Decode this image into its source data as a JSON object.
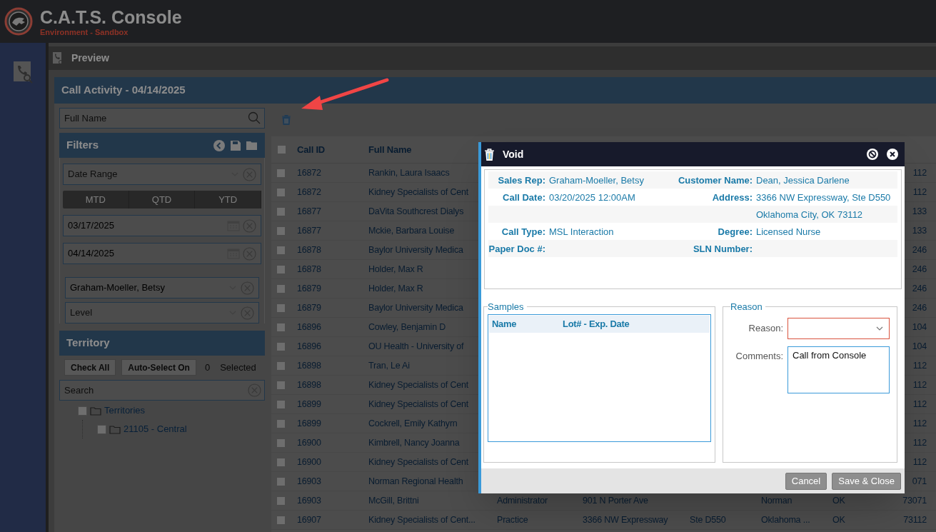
{
  "app": {
    "title": "C.A.T.S. Console",
    "environment": "Environment - Sandbox"
  },
  "breadcrumb": {
    "label": "Preview"
  },
  "panel": {
    "title": "Call Activity - 04/14/2025"
  },
  "filters": {
    "search": {
      "placeholder": "Full Name"
    },
    "title": "Filters",
    "date_range": {
      "placeholder": "Date Range"
    },
    "presets": [
      {
        "label": "MTD",
        "selected": false
      },
      {
        "label": "QTD",
        "selected": false
      },
      {
        "label": "YTD",
        "selected": false
      }
    ],
    "start_date": {
      "value": "03/17/2025"
    },
    "end_date": {
      "value": "04/14/2025"
    },
    "sales_rep": {
      "value": "Graham-Moeller, Betsy"
    },
    "level": {
      "placeholder": "Level"
    }
  },
  "territory": {
    "title": "Territory",
    "buttons": [
      "Check All",
      "Auto-Select On"
    ],
    "selected_count": "0",
    "selected_label": "Selected",
    "search": {
      "placeholder": "Search"
    },
    "tree": [
      {
        "label": "Territories",
        "checked": false,
        "children": [
          {
            "label": "21105 - Central",
            "checked": false
          }
        ]
      }
    ]
  },
  "table": {
    "columns": [
      "Call ID",
      "Full Name"
    ],
    "header_checked": false,
    "rows": [
      {
        "checked": false,
        "call_id": "16872",
        "full_name": "Rankin, Laura Isaacs",
        "column_8": "112"
      },
      {
        "checked": false,
        "call_id": "16872",
        "full_name": "Kidney Specialists of Cent",
        "column_8": "112"
      },
      {
        "checked": false,
        "call_id": "16877",
        "full_name": "DaVita Southcrest Dialys",
        "column_8": "133"
      },
      {
        "checked": false,
        "call_id": "16877",
        "full_name": "Mckie, Barbara Louise",
        "column_8": "133"
      },
      {
        "checked": false,
        "call_id": "16878",
        "full_name": "Baylor University Medica",
        "column_8": "246"
      },
      {
        "checked": false,
        "call_id": "16878",
        "full_name": "Holder, Max R",
        "column_8": "246"
      },
      {
        "checked": false,
        "call_id": "16879",
        "full_name": "Holder, Max R",
        "column_8": "246"
      },
      {
        "checked": false,
        "call_id": "16879",
        "full_name": "Baylor University Medica",
        "column_8": "246"
      },
      {
        "checked": false,
        "call_id": "16896",
        "full_name": "Cowley, Benjamin D",
        "column_8": "104"
      },
      {
        "checked": false,
        "call_id": "16896",
        "full_name": "OU Health - University of",
        "column_8": "104"
      },
      {
        "checked": false,
        "call_id": "16898",
        "full_name": "Tran, Le Ai",
        "column_8": "112"
      },
      {
        "checked": false,
        "call_id": "16898",
        "full_name": "Kidney Specialists of Cent",
        "column_8": "112"
      },
      {
        "checked": false,
        "call_id": "16899",
        "full_name": "Kidney Specialists of Cent",
        "column_8": "112"
      },
      {
        "checked": false,
        "call_id": "16899",
        "full_name": "Cockrell, Emily Kathyrn",
        "column_8": "112"
      },
      {
        "checked": false,
        "call_id": "16900",
        "full_name": "Kimbrell, Nancy Joanna",
        "column_8": "112"
      },
      {
        "checked": false,
        "call_id": "16900",
        "full_name": "Kidney Specialists of Cent",
        "column_8": "112"
      },
      {
        "checked": false,
        "call_id": "16903",
        "full_name": "Norman Regional Health",
        "column_8": "071"
      },
      {
        "checked": false,
        "call_id": "16903",
        "full_name": "McGill, Brittni",
        "column_3": "Administrator",
        "column_4": "901 N Porter Ave",
        "column_6": "Norman",
        "column_7": "OK",
        "column_8": "73071"
      },
      {
        "checked": false,
        "call_id": "16907",
        "full_name": "Kidney Specialists of Cent...",
        "column_3": "Practice",
        "column_4": "3366 NW Expressway",
        "column_5": "Ste D550",
        "column_6": "Oklahoma ...",
        "column_7": "OK",
        "column_8": "73112"
      }
    ]
  },
  "dialog": {
    "title": "Void",
    "details": [
      {
        "cells": [
          {
            "label": "Sales Rep:",
            "value": "Graham-Moeller, Betsy"
          },
          {
            "label": "Customer Name:",
            "value": "Dean, Jessica Darlene"
          }
        ]
      },
      {
        "cells": [
          {
            "label": "Call Date:",
            "value": "03/20/2025 12:00AM"
          },
          {
            "label": "Address:",
            "value": "3366 NW Expressway, Ste D550"
          }
        ]
      },
      {
        "cells": [
          {},
          {
            "value": "Oklahoma City, OK 73112"
          }
        ]
      },
      {
        "cells": [
          {
            "label": "Call Type:",
            "value": "MSL Interaction"
          },
          {
            "label": "Degree:",
            "value": "Licensed Nurse"
          }
        ]
      },
      {
        "cells": [
          {
            "label": "Paper Doc #:"
          },
          {
            "label": "SLN Number:"
          }
        ]
      }
    ],
    "samples": {
      "legend": "Samples",
      "columns": [
        "Name",
        "Lot# - Exp. Date"
      ]
    },
    "reason": {
      "legend": "Reason",
      "reason_label": "Reason:",
      "reason_invalid": true,
      "comments_label": "Comments:",
      "comments_value": "Call from Console"
    },
    "buttons": [
      "Cancel",
      "Save & Close"
    ]
  }
}
